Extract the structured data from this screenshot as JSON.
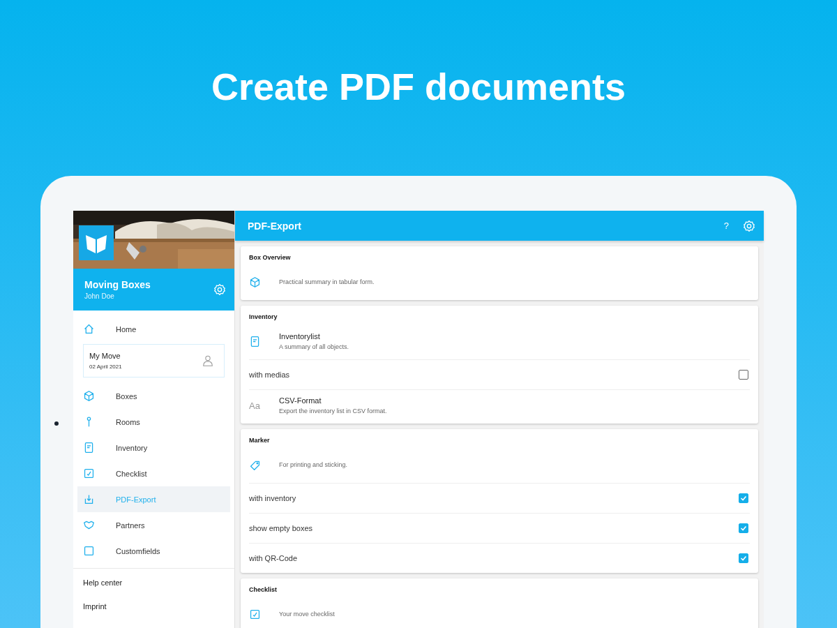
{
  "headline": "Create PDF documents",
  "sidebar": {
    "app_title": "Moving Boxes",
    "user": "John Doe",
    "nav_top": {
      "label": "Home",
      "selected": false
    },
    "move_card": {
      "title": "My Move",
      "date": "02 April 2021"
    },
    "items": [
      {
        "label": "Boxes",
        "selected": false
      },
      {
        "label": "Rooms",
        "selected": false
      },
      {
        "label": "Inventory",
        "selected": false
      },
      {
        "label": "Checklist",
        "selected": false
      },
      {
        "label": "PDF-Export",
        "selected": true
      },
      {
        "label": "Partners",
        "selected": false
      },
      {
        "label": "Customfields",
        "selected": false
      }
    ],
    "links": [
      "Help center",
      "Imprint"
    ]
  },
  "toolbar": {
    "title": "PDF-Export",
    "help": "?"
  },
  "sections": [
    {
      "title": "Box Overview",
      "rows": [
        {
          "kind": "info",
          "subtitle": "Practical summary in tabular form."
        }
      ]
    },
    {
      "title": "Inventory",
      "rows": [
        {
          "kind": "info",
          "title": "Inventorylist",
          "subtitle": "A summary of all objects."
        },
        {
          "kind": "toggle",
          "label": "with medias",
          "checked": false
        },
        {
          "kind": "glyph",
          "glyph": "Aa",
          "title": "CSV-Format",
          "subtitle": "Export the inventory list in CSV format."
        }
      ]
    },
    {
      "title": "Marker",
      "rows": [
        {
          "kind": "info",
          "subtitle": "For printing and sticking."
        },
        {
          "kind": "toggle",
          "label": "with inventory",
          "checked": true
        },
        {
          "kind": "toggle",
          "label": "show empty boxes",
          "checked": true
        },
        {
          "kind": "toggle",
          "label": "with QR-Code",
          "checked": true
        }
      ]
    },
    {
      "title": "Checklist",
      "rows": [
        {
          "kind": "info",
          "subtitle": "Your move checklist"
        }
      ]
    }
  ]
}
